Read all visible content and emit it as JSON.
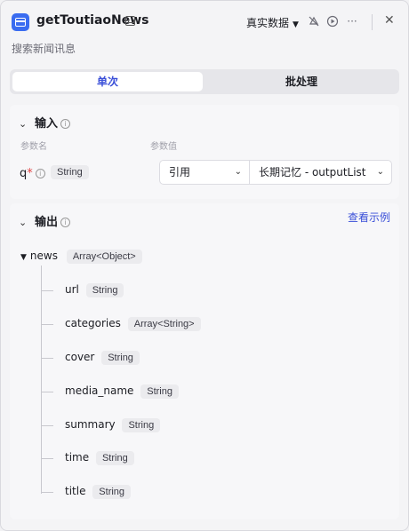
{
  "header": {
    "title": "getToutiaoNews",
    "mock_label": "真实数据",
    "subtitle": "搜索新闻讯息",
    "icons": [
      "app-icon",
      "edit-icon",
      "caret-down-icon",
      "link-off-icon",
      "play-icon",
      "more-icon",
      "close-icon"
    ]
  },
  "tabs": [
    {
      "label": "单次",
      "active": true
    },
    {
      "label": "批处理",
      "active": false
    }
  ],
  "input": {
    "title": "输入",
    "col_name": "参数名",
    "col_value": "参数值",
    "param": {
      "name": "q",
      "required_mark": "*",
      "type": "String",
      "ref_mode": "引用",
      "value": "长期记忆 - outputList"
    }
  },
  "output": {
    "title": "输出",
    "example_link": "查看示例",
    "root": {
      "name": "news",
      "type": "Array<Object>"
    },
    "fields": [
      {
        "name": "url",
        "type": "String"
      },
      {
        "name": "categories",
        "type": "Array<String>"
      },
      {
        "name": "cover",
        "type": "String"
      },
      {
        "name": "media_name",
        "type": "String"
      },
      {
        "name": "summary",
        "type": "String"
      },
      {
        "name": "time",
        "type": "String"
      },
      {
        "name": "title",
        "type": "String"
      }
    ]
  },
  "colors": {
    "accent": "#3a4fd8",
    "app_icon": "#3a6cf0",
    "required": "#e24545"
  }
}
